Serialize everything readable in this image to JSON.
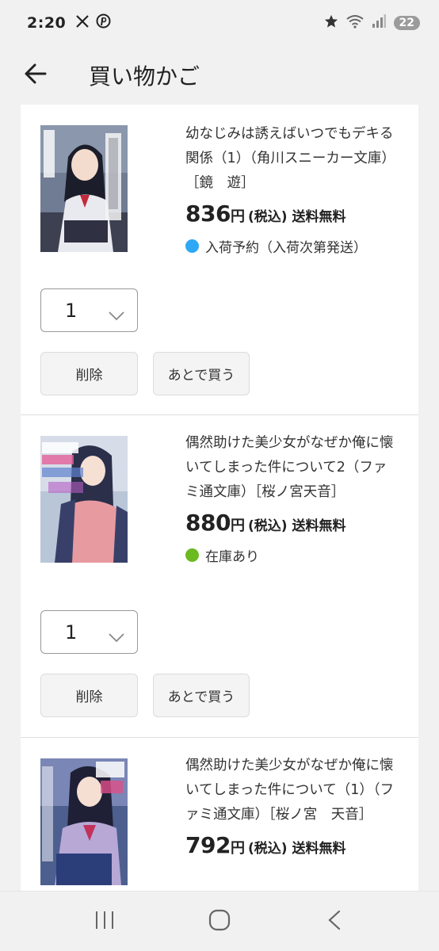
{
  "status_bar": {
    "time": "2:20",
    "battery": "22",
    "icons": [
      "x-icon",
      "pinterest-icon",
      "star-icon",
      "wifi-icon",
      "signal-icon"
    ]
  },
  "header": {
    "title": "買い物かご",
    "back_icon": "arrow-left-icon"
  },
  "items": [
    {
      "title": "幼なじみは誘えばいつでもデキる関係（1）（角川スニーカー文庫）［鏡　遊］",
      "price": "836",
      "yen": "円",
      "tax": "(税込)",
      "shipping": "送料無料",
      "stock_text": "入荷予約（入荷次第発送）",
      "stock_color": "#2ea8f5",
      "quantity": "1",
      "delete_label": "削除",
      "later_label": "あとで買う"
    },
    {
      "title": "偶然助けた美少女がなぜか俺に懐いてしまった件について2（ファミ通文庫）［桜ノ宮天音］",
      "price": "880",
      "yen": "円",
      "tax": "(税込)",
      "shipping": "送料無料",
      "stock_text": "在庫あり",
      "stock_color": "#6cba22",
      "quantity": "1",
      "delete_label": "削除",
      "later_label": "あとで買う"
    },
    {
      "title": "偶然助けた美少女がなぜか俺に懐いてしまった件について（1）（ファミ通文庫）［桜ノ宮　天音］",
      "price": "792",
      "yen": "円",
      "tax": "(税込)",
      "shipping": "送料無料"
    }
  ],
  "nav_bar": {
    "icons": [
      "recent-apps-icon",
      "home-icon",
      "back-icon"
    ]
  }
}
